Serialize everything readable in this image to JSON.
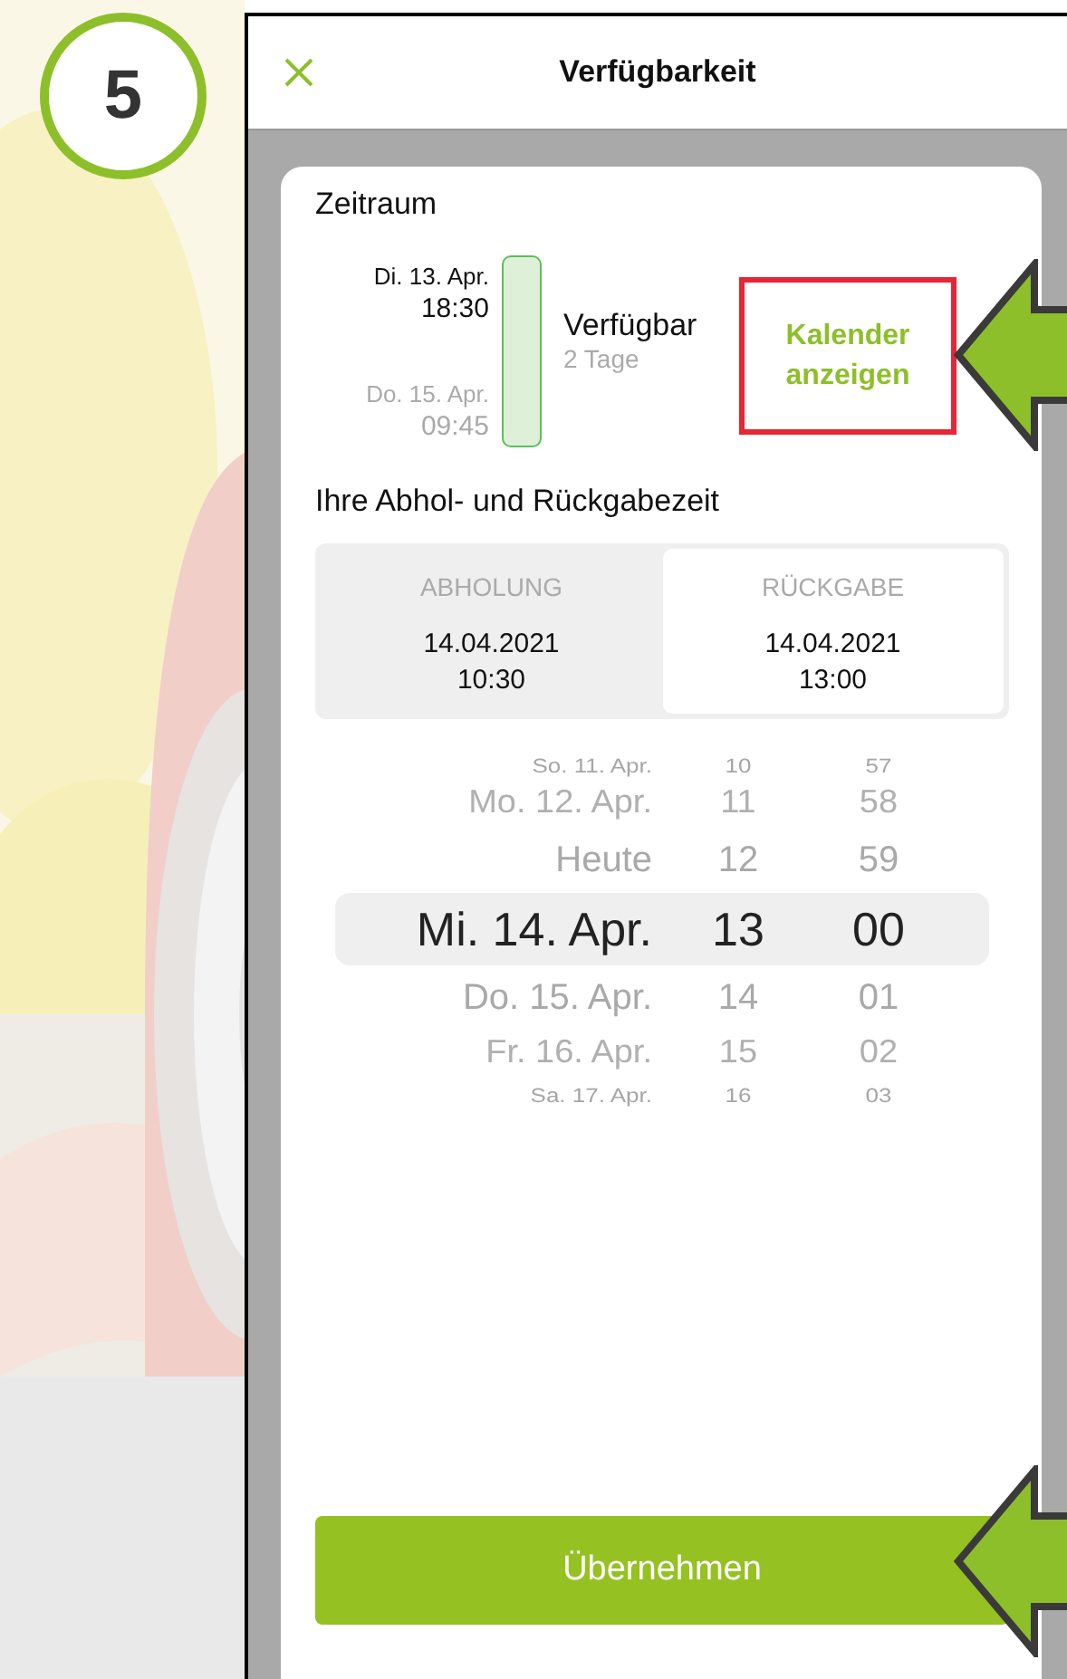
{
  "step_badge": "5",
  "header": {
    "title": "Verfügbarkeit"
  },
  "period": {
    "heading": "Zeitraum",
    "start": {
      "date": "Di. 13. Apr.",
      "time": "18:30"
    },
    "end": {
      "date": "Do. 15. Apr.",
      "time": "09:45"
    },
    "status": "Verfügbar",
    "duration": "2 Tage",
    "calendar_link": "Kalender anzeigen"
  },
  "times": {
    "heading": "Ihre Abhol- und Rückgabezeit",
    "segments": [
      {
        "label": "ABHOLUNG",
        "date": "14.04.2021",
        "time": "10:30",
        "selected": false
      },
      {
        "label": "RÜCKGABE",
        "date": "14.04.2021",
        "time": "13:00",
        "selected": true
      }
    ]
  },
  "picker": {
    "rows": [
      {
        "date": "So. 11. Apr.",
        "hour": "10",
        "minute": "57",
        "selected": false
      },
      {
        "date": "Mo. 12. Apr.",
        "hour": "11",
        "minute": "58",
        "selected": false
      },
      {
        "date": "Heute",
        "hour": "12",
        "minute": "59",
        "selected": false
      },
      {
        "date": "Mi. 14. Apr.",
        "hour": "13",
        "minute": "00",
        "selected": true
      },
      {
        "date": "Do. 15. Apr.",
        "hour": "14",
        "minute": "01",
        "selected": false
      },
      {
        "date": "Fr. 16. Apr.",
        "hour": "15",
        "minute": "02",
        "selected": false
      },
      {
        "date": "Sa. 17. Apr.",
        "hour": "16",
        "minute": "03",
        "selected": false
      }
    ]
  },
  "button": "Übernehmen"
}
